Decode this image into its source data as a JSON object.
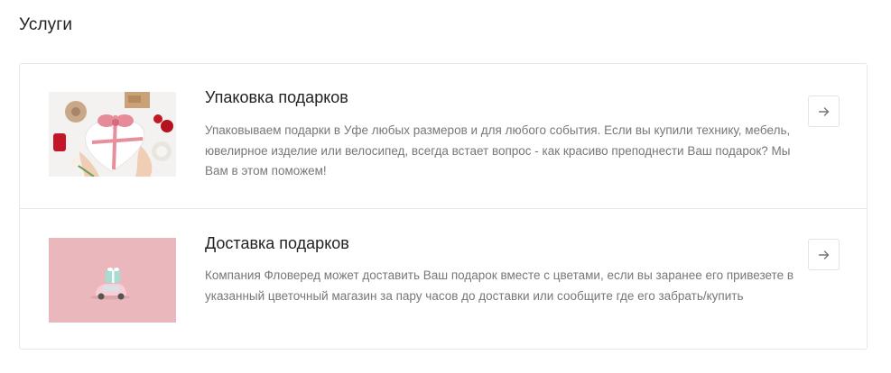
{
  "page": {
    "title": "Услуги"
  },
  "services": [
    {
      "title": "Упаковка подарков",
      "description": "Упаковываем подарки в Уфе любых размеров и для любого события. Если вы купили технику, мебель, ювелирное изделие или велосипед, всегда встает вопрос - как красиво преподнести Ваш подарок? Мы Вам в этом поможем!",
      "image": "gift-wrapping-photo",
      "action_icon": "arrow-right-icon"
    },
    {
      "title": "Доставка подарков",
      "description": "Компания Фловеред может доставить Ваш подарок вместе с цветами, если вы заранее его привезете в указанный цветочный магазин за пару часов до доставки или сообщите где его забрать/купить",
      "image": "gift-delivery-photo",
      "action_icon": "arrow-right-icon"
    }
  ],
  "colors": {
    "border": "#e8e8e8",
    "text": "#222222",
    "muted": "#777777",
    "pink_bg": "#eab7bd"
  }
}
